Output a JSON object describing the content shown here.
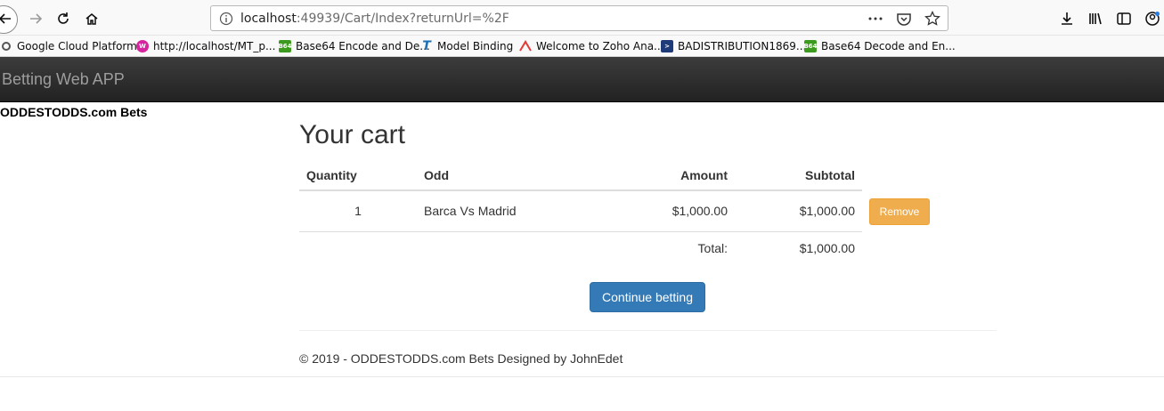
{
  "browser": {
    "url_host": "localhost",
    "url_path": ":49939/Cart/Index?returnUrl=%2F"
  },
  "bookmarks": [
    {
      "label": "Google Cloud Platform",
      "icon": "gear-icon",
      "color": "#666666"
    },
    {
      "label": "http://localhost/MT_p...",
      "icon": "webapp-icon",
      "color": "#d6249f"
    },
    {
      "label": "Base64 Encode and De...",
      "icon": "b64-icon",
      "color": "#3c9a1e"
    },
    {
      "label": "Model Binding",
      "icon": "t-icon",
      "color": "#1f6fb5"
    },
    {
      "label": "Welcome to Zoho Ana...",
      "icon": "zoho-icon",
      "color": "#e53935"
    },
    {
      "label": "BADISTRIBUTION1869...",
      "icon": "vs-icon",
      "color": "#1e3a78"
    },
    {
      "label": "Base64 Decode and En...",
      "icon": "b64-icon",
      "color": "#3c9a1e"
    }
  ],
  "navbar": {
    "brand": "Betting Web APP"
  },
  "side_title": "ODDESTODDS.com Bets",
  "page_title": "Your cart",
  "cart": {
    "headers": {
      "quantity": "Quantity",
      "odd": "Odd",
      "amount": "Amount",
      "subtotal": "Subtotal"
    },
    "rows": [
      {
        "quantity": "1",
        "odd": "Barca Vs Madrid",
        "amount": "$1,000.00",
        "subtotal": "$1,000.00"
      }
    ],
    "total_label": "Total:",
    "total_value": "$1,000.00",
    "remove_label": "Remove"
  },
  "continue_label": "Continue betting",
  "footer": "© 2019 - ODDESTODDS.com Bets Designed by JohnEdet",
  "colors": {
    "remove_button": "#f0ad4e",
    "primary_button": "#337ab7",
    "navbar": "#222222"
  }
}
